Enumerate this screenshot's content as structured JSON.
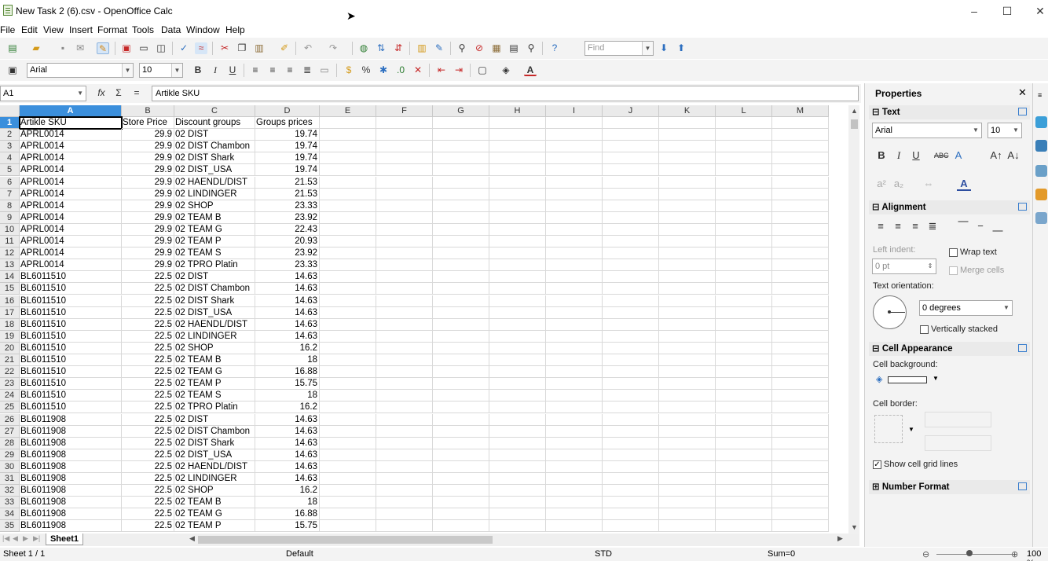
{
  "window": {
    "title": "New Task 2 (6).csv - OpenOffice Calc",
    "minimize": "–",
    "maximize": "☐",
    "close": "✕"
  },
  "menu": [
    "File",
    "Edit",
    "View",
    "Insert",
    "Format",
    "Tools",
    "Data",
    "Window",
    "Help"
  ],
  "toolbar": {
    "find_placeholder": "Find",
    "font_name": "Arial",
    "font_size": "10"
  },
  "formula_bar": {
    "cell_ref": "A1",
    "content": "Artikle SKU"
  },
  "sheet": {
    "columns": [
      "A",
      "B",
      "C",
      "D",
      "E",
      "F",
      "G",
      "H",
      "I",
      "J",
      "K",
      "L",
      "M"
    ],
    "rows": [
      [
        "Artikle SKU",
        "Store Price",
        "Discount groups",
        "Groups prices"
      ],
      [
        "APRL0014",
        "29.9",
        "02 DIST",
        "19.74"
      ],
      [
        "APRL0014",
        "29.9",
        "02 DIST Chambon",
        "19.74"
      ],
      [
        "APRL0014",
        "29.9",
        "02 DIST Shark",
        "19.74"
      ],
      [
        "APRL0014",
        "29.9",
        "02 DIST_USA",
        "19.74"
      ],
      [
        "APRL0014",
        "29.9",
        "02 HAENDL/DIST",
        "21.53"
      ],
      [
        "APRL0014",
        "29.9",
        "02 LINDINGER",
        "21.53"
      ],
      [
        "APRL0014",
        "29.9",
        "02 SHOP",
        "23.33"
      ],
      [
        "APRL0014",
        "29.9",
        "02 TEAM B",
        "23.92"
      ],
      [
        "APRL0014",
        "29.9",
        "02 TEAM G",
        "22.43"
      ],
      [
        "APRL0014",
        "29.9",
        "02 TEAM P",
        "20.93"
      ],
      [
        "APRL0014",
        "29.9",
        "02 TEAM S",
        "23.92"
      ],
      [
        "APRL0014",
        "29.9",
        "02 TPRO Platin",
        "23.33"
      ],
      [
        "BL6011510",
        "22.5",
        "02 DIST",
        "14.63"
      ],
      [
        "BL6011510",
        "22.5",
        "02 DIST Chambon",
        "14.63"
      ],
      [
        "BL6011510",
        "22.5",
        "02 DIST Shark",
        "14.63"
      ],
      [
        "BL6011510",
        "22.5",
        "02 DIST_USA",
        "14.63"
      ],
      [
        "BL6011510",
        "22.5",
        "02 HAENDL/DIST",
        "14.63"
      ],
      [
        "BL6011510",
        "22.5",
        "02 LINDINGER",
        "14.63"
      ],
      [
        "BL6011510",
        "22.5",
        "02 SHOP",
        "16.2"
      ],
      [
        "BL6011510",
        "22.5",
        "02 TEAM B",
        "18"
      ],
      [
        "BL6011510",
        "22.5",
        "02 TEAM G",
        "16.88"
      ],
      [
        "BL6011510",
        "22.5",
        "02 TEAM P",
        "15.75"
      ],
      [
        "BL6011510",
        "22.5",
        "02 TEAM S",
        "18"
      ],
      [
        "BL6011510",
        "22.5",
        "02 TPRO Platin",
        "16.2"
      ],
      [
        "BL6011908",
        "22.5",
        "02 DIST",
        "14.63"
      ],
      [
        "BL6011908",
        "22.5",
        "02 DIST Chambon",
        "14.63"
      ],
      [
        "BL6011908",
        "22.5",
        "02 DIST Shark",
        "14.63"
      ],
      [
        "BL6011908",
        "22.5",
        "02 DIST_USA",
        "14.63"
      ],
      [
        "BL6011908",
        "22.5",
        "02 HAENDL/DIST",
        "14.63"
      ],
      [
        "BL6011908",
        "22.5",
        "02 LINDINGER",
        "14.63"
      ],
      [
        "BL6011908",
        "22.5",
        "02 SHOP",
        "16.2"
      ],
      [
        "BL6011908",
        "22.5",
        "02 TEAM B",
        "18"
      ],
      [
        "BL6011908",
        "22.5",
        "02 TEAM G",
        "16.88"
      ],
      [
        "BL6011908",
        "22.5",
        "02 TEAM P",
        "15.75"
      ]
    ],
    "tab": "Sheet1"
  },
  "status": {
    "sheet": "Sheet 1 / 1",
    "style": "Default",
    "mode": "STD",
    "sum": "Sum=0",
    "zoom": "100 %"
  },
  "sidebar": {
    "title": "Properties",
    "text_section": "Text",
    "font_name": "Arial",
    "font_size": "10",
    "alignment_section": "Alignment",
    "left_indent_label": "Left indent:",
    "left_indent_value": "0 pt",
    "wrap_text": "Wrap text",
    "merge_cells": "Merge cells",
    "text_orientation_label": "Text orientation:",
    "orientation_value": "0 degrees",
    "vertically_stacked": "Vertically stacked",
    "cell_appearance_section": "Cell Appearance",
    "cell_background_label": "Cell background:",
    "cell_border_label": "Cell border:",
    "show_grid_lines": "Show cell grid lines",
    "number_format_section": "Number Format"
  },
  "colors": {
    "selection": "#3b8fdc",
    "accent": "#3b7fce"
  }
}
